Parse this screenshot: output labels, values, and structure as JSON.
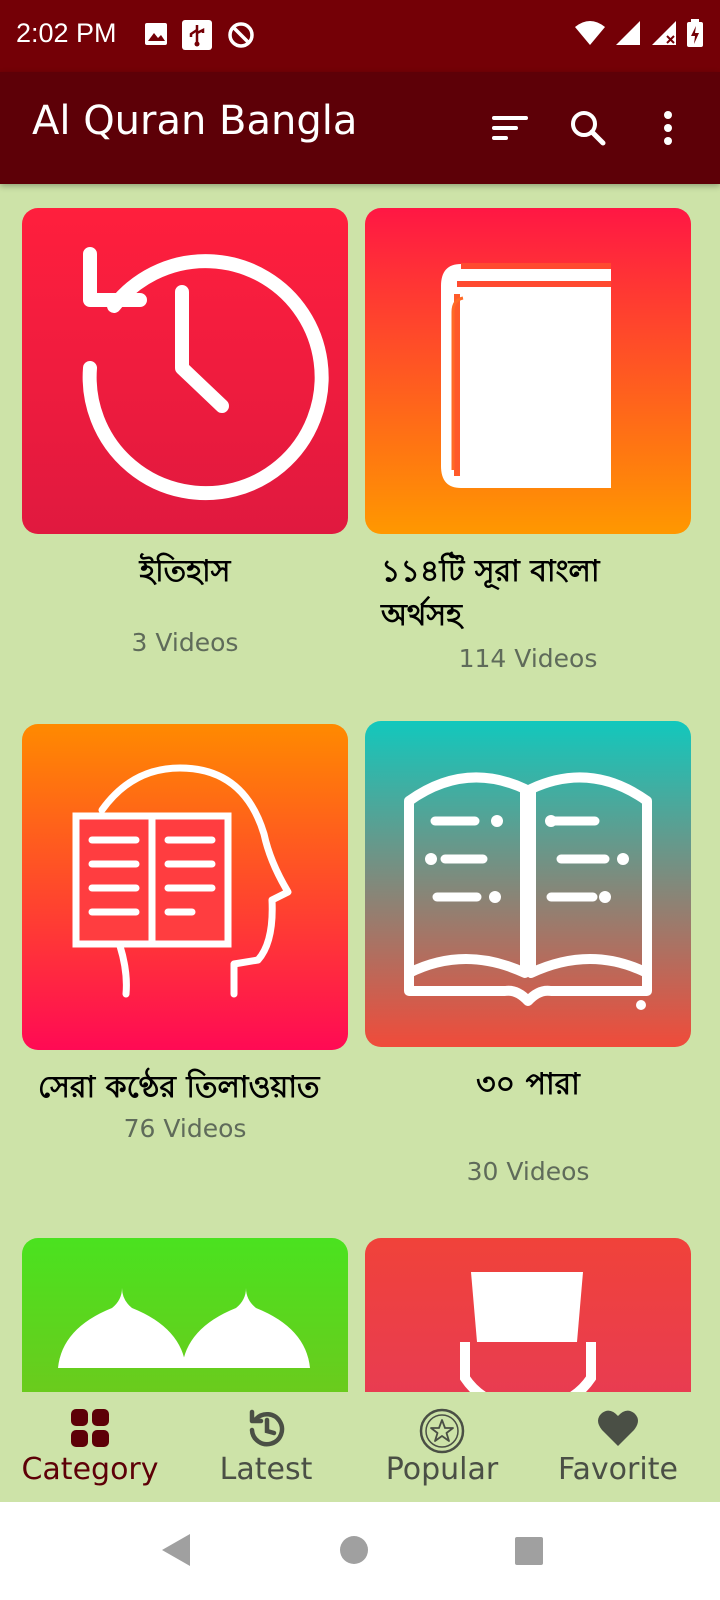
{
  "status_bar": {
    "time": "2:02 PM",
    "icons_left": [
      "image-icon",
      "usb-icon",
      "do-not-disturb-icon"
    ],
    "icons_right": [
      "wifi-icon",
      "signal-icon",
      "signal-x-icon",
      "battery-charging-icon"
    ]
  },
  "app_bar": {
    "title": "Al Quran Bangla",
    "actions": [
      "sort-icon",
      "search-icon",
      "more-vert-icon"
    ]
  },
  "categories": [
    {
      "title": "ইতিহাস",
      "count": "3 Videos",
      "icon": "history-clock-icon",
      "gradient": [
        "#ff1f3d",
        "#e0193f"
      ]
    },
    {
      "title": "১১৪টি সূরা বাংলা অর্থসহ",
      "count": "114 Videos",
      "icon": "book-icon",
      "gradient": [
        "#ff1744",
        "#ff9800"
      ]
    },
    {
      "title": "সেরা কণ্ঠের তিলাওয়াত",
      "count": "76 Videos",
      "icon": "reading-head-icon",
      "gradient": [
        "#ff8a00",
        "#ff0a54"
      ]
    },
    {
      "title": "৩০ পারা",
      "count": "30 Videos",
      "icon": "open-quran-icon",
      "gradient": [
        "#12c8bd",
        "#f04b3a"
      ]
    },
    {
      "title": "",
      "count": "",
      "icon": "mosque-domes-icon",
      "gradient": [
        "#4ae21f",
        "#8fb11b"
      ]
    },
    {
      "title": "",
      "count": "",
      "icon": "person-cap-icon",
      "gradient": [
        "#f0423a",
        "#e0366a"
      ]
    }
  ],
  "bottom_nav": {
    "items": [
      {
        "label": "Category",
        "icon": "grid-icon",
        "active": true
      },
      {
        "label": "Latest",
        "icon": "history-icon",
        "active": false
      },
      {
        "label": "Popular",
        "icon": "star-badge-icon",
        "active": false
      },
      {
        "label": "Favorite",
        "icon": "heart-icon",
        "active": false
      }
    ]
  },
  "colors": {
    "status_bar": "#740006",
    "app_bar": "#5d0007",
    "background": "#cde3a8",
    "active_nav": "#5d0007"
  }
}
